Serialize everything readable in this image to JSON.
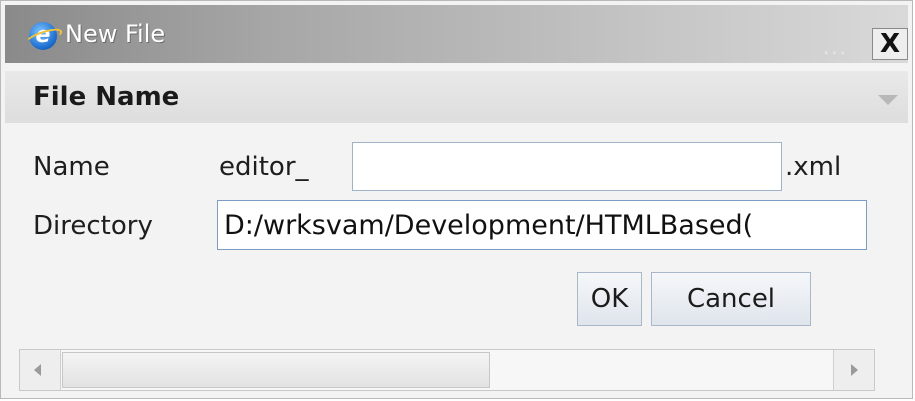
{
  "window": {
    "title": "New File",
    "close_label": "X",
    "title_icon": "ie-icon"
  },
  "section": {
    "label": "File Name",
    "collapse_icon": "collapse-triangle-icon"
  },
  "form": {
    "name_label": "Name",
    "name_prefix": "editor_",
    "name_value": "",
    "name_suffix": ".xml",
    "directory_label": "Directory",
    "directory_value": "D:/wrksvam/Development/HTMLBased("
  },
  "buttons": {
    "ok": "OK",
    "cancel": "Cancel"
  },
  "scrollbar": {
    "left_icon": "scroll-left-icon",
    "right_icon": "scroll-right-icon"
  }
}
